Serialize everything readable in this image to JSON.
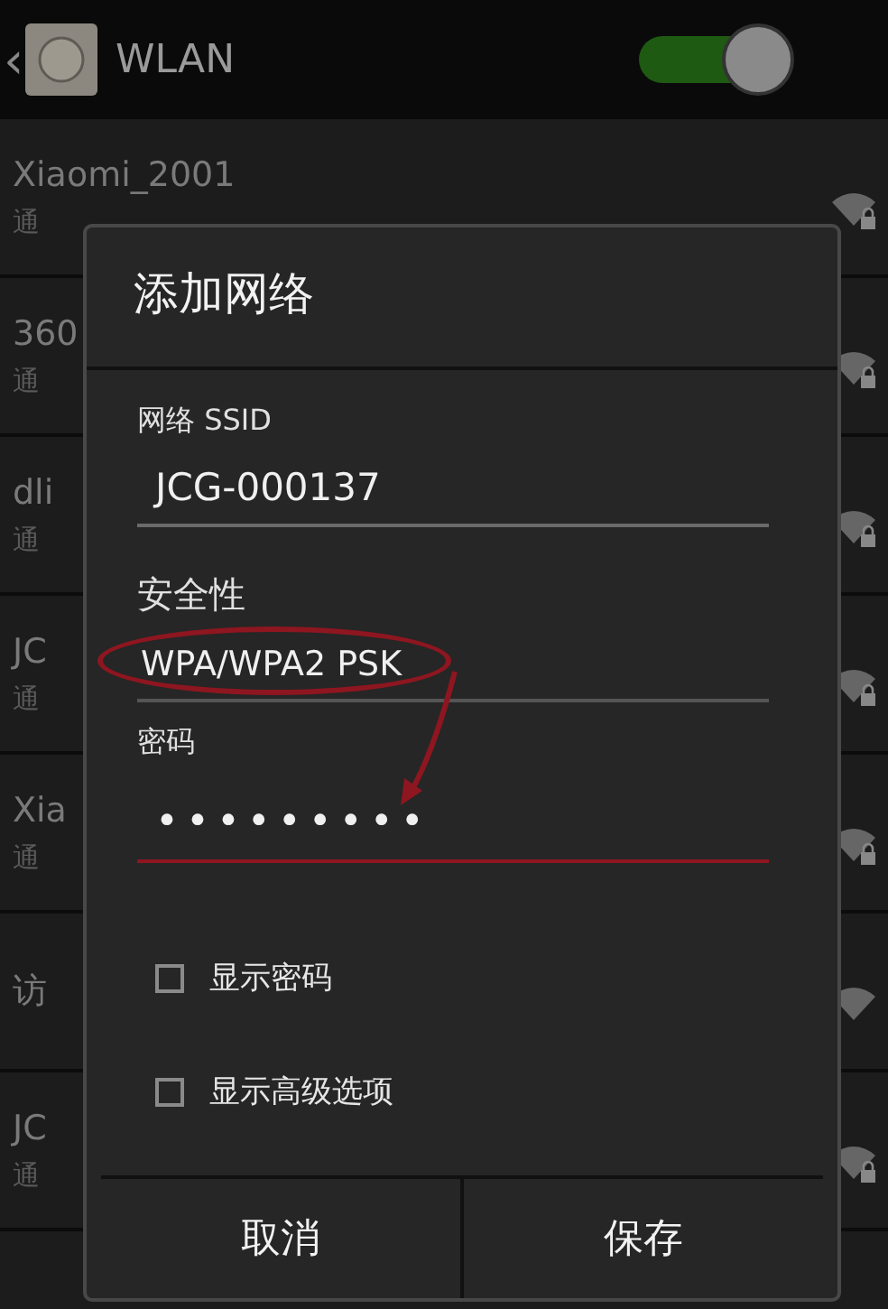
{
  "header": {
    "back": "‹",
    "title": "WLAN",
    "toggle": {
      "on": true
    }
  },
  "networks": [
    {
      "name": "Xiaomi_2001",
      "security": "通",
      "locked": true
    },
    {
      "name": "360",
      "security": "通",
      "locked": true
    },
    {
      "name": "dli",
      "security": "通",
      "locked": true
    },
    {
      "name": "JC",
      "security": "通",
      "locked": true
    },
    {
      "name": "Xia",
      "security": "通",
      "locked": true
    },
    {
      "name": "访",
      "locked": false
    },
    {
      "name": "JC",
      "security": "通",
      "locked": true
    }
  ],
  "dialog": {
    "title": "添加网络",
    "ssid": {
      "label": "网络 SSID",
      "value": "JCG-000137"
    },
    "security": {
      "label": "安全性",
      "value": "WPA/WPA2 PSK"
    },
    "password": {
      "label": "密码",
      "value": "•••••••••",
      "focused": true
    },
    "checkboxes": [
      {
        "label": "显示密码",
        "checked": false
      },
      {
        "label": "显示高级选项",
        "checked": false
      }
    ],
    "buttons": [
      "取消",
      "保存"
    ]
  }
}
